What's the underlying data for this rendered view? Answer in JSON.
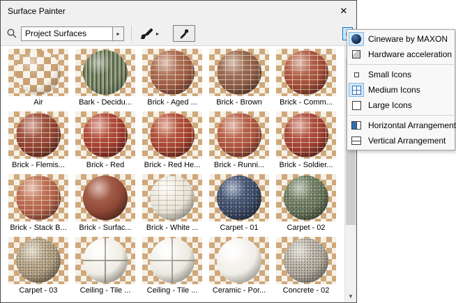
{
  "window": {
    "title": "Surface Painter",
    "close_glyph": "✕"
  },
  "toolbar": {
    "filter_value": "Project Surfaces",
    "filter_dropdown_glyph": "▸",
    "brush_dropdown_glyph": "▸",
    "menu_button_glyph": "▸"
  },
  "scrollbar": {
    "up_glyph": "▲",
    "down_glyph": "▼"
  },
  "colors": {
    "accent": "#0078d7",
    "selection_bg": "#cce4f7",
    "tile_tan": "#cfa87b",
    "tile_cream": "#f6f1e7"
  },
  "materials": [
    {
      "name": "Air",
      "texture": "checker",
      "base": "#c9a173",
      "light": "#f7f3ea",
      "dark": "#8a6a45"
    },
    {
      "name": "Bark - Decidu...",
      "texture": "bark",
      "base": "#7d8a6b",
      "light": "#a3ad8f",
      "dark": "#4f5a42"
    },
    {
      "name": "Brick - Aged ...",
      "texture": "brick",
      "base": "#9c5a41",
      "light": "#c08a6e",
      "dark": "#5f3425"
    },
    {
      "name": "Brick - Brown",
      "texture": "brick",
      "base": "#8a5a44",
      "light": "#b08468",
      "dark": "#4f2f22"
    },
    {
      "name": "Brick - Comm...",
      "texture": "brick",
      "base": "#a04a36",
      "light": "#c47a62",
      "dark": "#5e2a1d"
    },
    {
      "name": "Brick - Flemis...",
      "texture": "brick",
      "base": "#8e3f30",
      "light": "#b56a55",
      "dark": "#4f221a"
    },
    {
      "name": "Brick - Red",
      "texture": "brick",
      "base": "#a03a2c",
      "light": "#c76a55",
      "dark": "#5a1f16"
    },
    {
      "name": "Brick - Red He...",
      "texture": "brick",
      "base": "#a4402e",
      "light": "#ca7058",
      "dark": "#5c2418"
    },
    {
      "name": "Brick - Runni...",
      "texture": "brick",
      "base": "#a8503c",
      "light": "#cc7e64",
      "dark": "#5f2c20"
    },
    {
      "name": "Brick - Soldier...",
      "texture": "brick",
      "base": "#9e3d2f",
      "light": "#c46a57",
      "dark": "#57211a"
    },
    {
      "name": "Brick - Stack B...",
      "texture": "brick",
      "base": "#b05f46",
      "light": "#d28c6e",
      "dark": "#643226"
    },
    {
      "name": "Brick - Surfac...",
      "texture": "plain",
      "base": "#8f4836",
      "light": "#b87660",
      "dark": "#4e241b"
    },
    {
      "name": "Brick - White ...",
      "texture": "brick",
      "base": "#e9e4d8",
      "light": "#fbf8f0",
      "dark": "#9a948a",
      "mortar": "rgba(150,140,130,0.5)"
    },
    {
      "name": "Carpet - 01",
      "texture": "speckle",
      "base": "#41506b",
      "light": "#66779b",
      "dark": "#232c3e"
    },
    {
      "name": "Carpet - 02",
      "texture": "speckle",
      "base": "#6e7c60",
      "light": "#93a184",
      "dark": "#3f4a36"
    },
    {
      "name": "Carpet - 03",
      "texture": "speckle",
      "base": "#b3a184",
      "light": "#d6c7ab",
      "dark": "#6e5f4b"
    },
    {
      "name": "Ceiling - Tile ...",
      "texture": "tile",
      "base": "#efece3",
      "light": "#ffffff",
      "dark": "#9a978d"
    },
    {
      "name": "Ceiling - Tile ...",
      "texture": "tile",
      "base": "#ece9df",
      "light": "#ffffff",
      "dark": "#a5a298"
    },
    {
      "name": "Ceramic - Por...",
      "texture": "plain",
      "base": "#f0ede7",
      "light": "#ffffff",
      "dark": "#b5b2aa"
    },
    {
      "name": "Concrete - 02",
      "texture": "speckle",
      "base": "#b4ada0",
      "light": "#d6d0c4",
      "dark": "#7b7569"
    }
  ],
  "menu": {
    "items": [
      {
        "type": "item",
        "name": "cineware",
        "icon": "cineware-icon",
        "label": "Cineware by MAXON",
        "selected": true
      },
      {
        "type": "item",
        "name": "hardware-acceleration",
        "icon": "hardware-acceleration-icon",
        "label": "Hardware acceleration",
        "selected": false
      },
      {
        "type": "separator"
      },
      {
        "type": "item",
        "name": "small-icons",
        "icon": "small-icons-icon",
        "label": "Small Icons",
        "selected": false
      },
      {
        "type": "item",
        "name": "medium-icons",
        "icon": "medium-icons-icon",
        "label": "Medium Icons",
        "selected": true
      },
      {
        "type": "item",
        "name": "large-icons",
        "icon": "large-icons-icon",
        "label": "Large Icons",
        "selected": false
      },
      {
        "type": "separator"
      },
      {
        "type": "item",
        "name": "horizontal-arrangement",
        "icon": "horizontal-arrangement-icon",
        "label": "Horizontal Arrangement",
        "selected": false
      },
      {
        "type": "item",
        "name": "vertical-arrangement",
        "icon": "vertical-arrangement-icon",
        "label": "Vertical Arrangement",
        "selected": false
      }
    ]
  }
}
